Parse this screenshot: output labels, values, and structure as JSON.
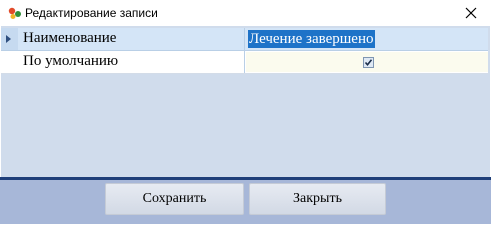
{
  "window": {
    "title": "Редактирование записи",
    "icon": "app-icon",
    "close_icon": "close-icon"
  },
  "grid": {
    "rows": [
      {
        "label": "Наименование",
        "value": "Лечение завершено",
        "selected": true
      },
      {
        "label": "По умолчанию",
        "checked": true
      }
    ]
  },
  "buttons": {
    "save_label": "Сохранить",
    "close_label": "Закрыть"
  },
  "colors": {
    "selection": "#1e73c8",
    "grid_background": "#d0dcec",
    "bottom_panel": "#a7b7d8",
    "separator": "#1f3f7a"
  }
}
